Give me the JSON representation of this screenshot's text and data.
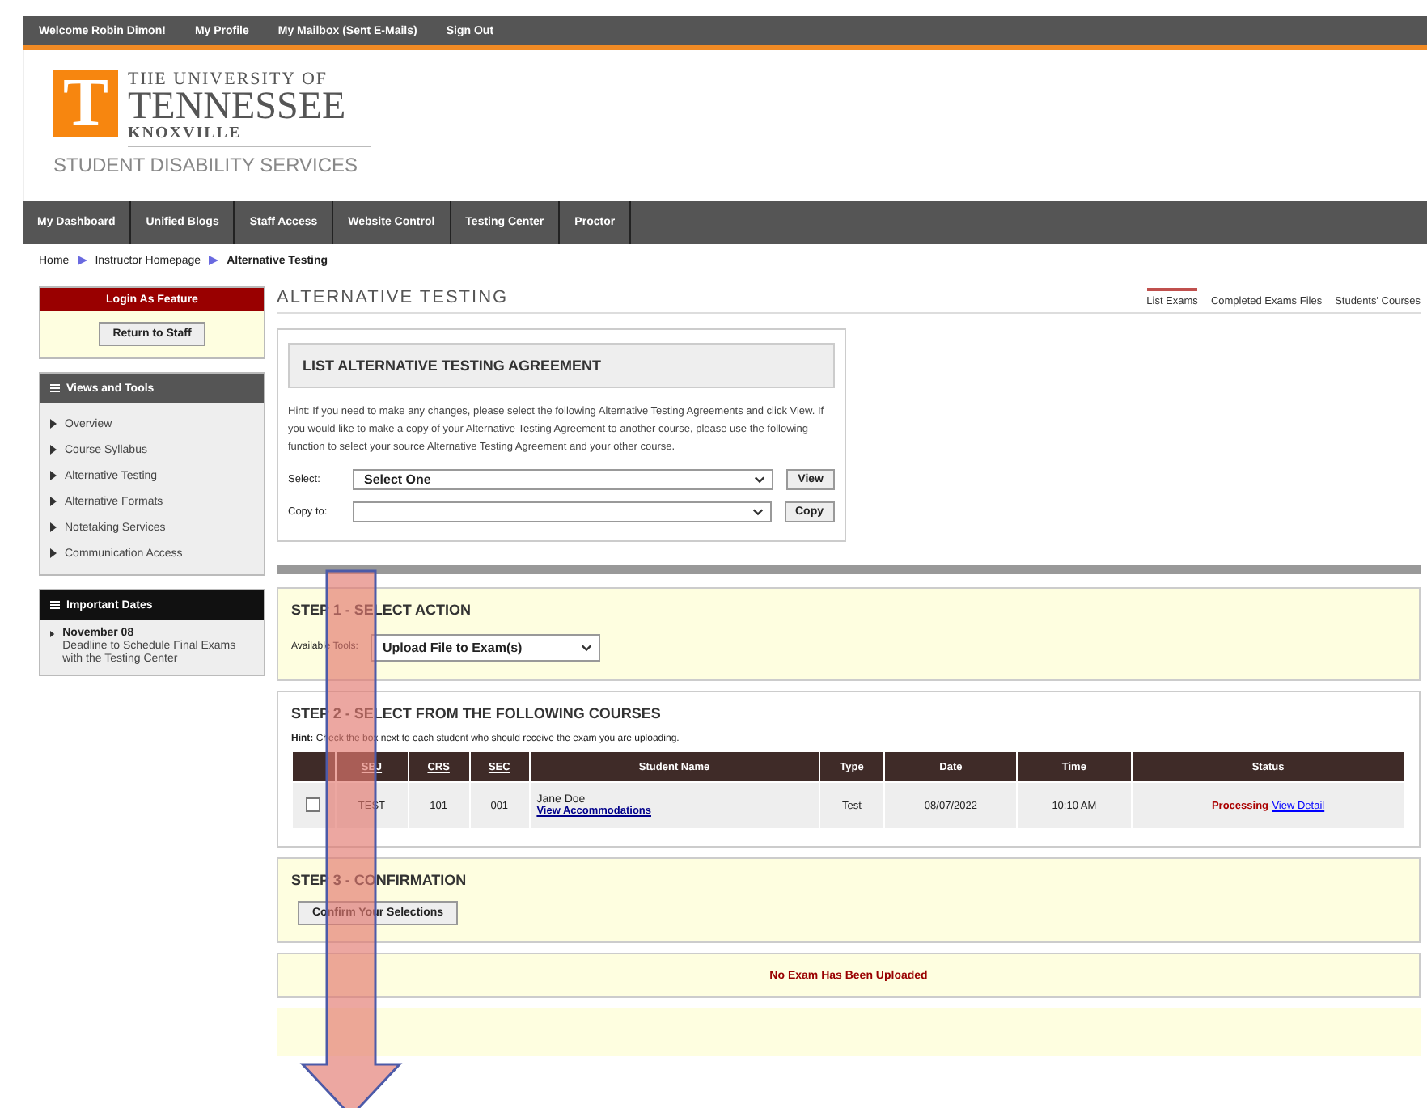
{
  "top_bar": {
    "links": [
      "Welcome Robin Dimon!",
      "My Profile",
      "My Mailbox (Sent E-Mails)",
      "Sign Out"
    ]
  },
  "header": {
    "logo_mark": "T",
    "logo_line_1": "THE UNIVERSITY OF",
    "logo_line_2": "TENNESSEE",
    "logo_line_3": "KNOXVILLE",
    "department": "STUDENT DISABILITY SERVICES"
  },
  "nav": [
    "My Dashboard",
    "Unified Blogs",
    "Staff Access",
    "Website Control",
    "Testing Center",
    "Proctor"
  ],
  "breadcrumb": {
    "items": [
      "Home",
      "Instructor Homepage"
    ],
    "current": "Alternative Testing"
  },
  "sidebar": {
    "login": {
      "title": "Login As Feature",
      "button": "Return to Staff"
    },
    "views": {
      "title": "Views and Tools",
      "items": [
        "Overview",
        "Course Syllabus",
        "Alternative Testing",
        "Alternative Formats",
        "Notetaking Services",
        "Communication Access"
      ]
    },
    "dates": {
      "title": "Important Dates",
      "items": [
        {
          "date": "November 08",
          "text": "Deadline to Schedule Final Exams with the Testing Center"
        }
      ]
    }
  },
  "page_title": "ALTERNATIVE TESTING",
  "tabs": [
    {
      "label": "List Exams",
      "selected": true
    },
    {
      "label": "Completed Exams Files",
      "selected": false
    },
    {
      "label": "Students' Courses",
      "selected": false
    }
  ],
  "agreement": {
    "title": "LIST ALTERNATIVE TESTING AGREEMENT",
    "hint": "Hint: If you need to make any changes, please select the following Alternative Testing Agreements and click View. If you would like to make a copy of your Alternative Testing Agreement to another course, please use the following function to select your source Alternative Testing Agreement and your other course.",
    "fields": [
      {
        "label": "Select:",
        "value": "Select One",
        "button": "View"
      },
      {
        "label": "Copy to:",
        "button": "Copy"
      }
    ]
  },
  "step1": {
    "title": "STEP 1 - SELECT ACTION",
    "label": "Available Tools:",
    "value": "Upload File to Exam(s)"
  },
  "step2": {
    "title": "STEP 2 - SELECT FROM THE FOLLOWING COURSES",
    "hint_label": "Hint:",
    "hint": "Check the box next to each student who should receive the exam you are uploading.",
    "columns": [
      {
        "label": "SBJ",
        "sortable": true
      },
      {
        "label": "CRS",
        "sortable": true
      },
      {
        "label": "SEC",
        "sortable": true
      },
      {
        "label": "Student Name",
        "sortable": false
      },
      {
        "label": "Type",
        "sortable": false
      },
      {
        "label": "Date",
        "sortable": false
      },
      {
        "label": "Time",
        "sortable": false
      },
      {
        "label": "Status",
        "sortable": false
      }
    ],
    "rows": [
      {
        "checked": false,
        "sbj": "TEST",
        "crs": "101",
        "sec": "001",
        "student": "Jane Doe",
        "link": "View Accommodations",
        "type": "Test",
        "date": "08/07/2022",
        "time": "10:10 AM",
        "status": "Processing",
        "separator": "-",
        "status_link": "View Detail"
      }
    ]
  },
  "step3": {
    "title": "STEP 3 - CONFIRMATION",
    "button": "Confirm Your Selections"
  },
  "message": "No Exam Has Been Uploaded"
}
